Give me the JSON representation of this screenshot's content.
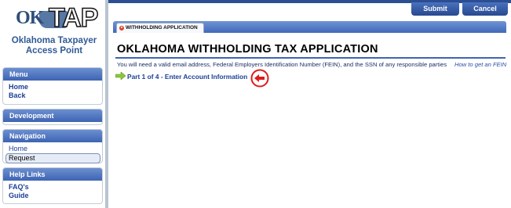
{
  "logo": {
    "ok": "OK",
    "tap": "TAP",
    "line1": "Oklahoma Taxpayer",
    "line2": "Access Point"
  },
  "topbar": {
    "submit_label": "Submit",
    "cancel_label": "Cancel"
  },
  "sidebar": {
    "menu": {
      "title": "Menu",
      "items": [
        "Home",
        "Back"
      ]
    },
    "development": {
      "title": "Development"
    },
    "navigation": {
      "title": "Navigation",
      "items": [
        "Home",
        "Request"
      ]
    },
    "help": {
      "title": "Help Links",
      "items": [
        "FAQ's",
        "Guide"
      ]
    }
  },
  "tab": {
    "label": "WITHHOLDING APPLICATION"
  },
  "main": {
    "title": "OKLAHOMA WITHHOLDING TAX APPLICATION",
    "instructions": "You will need a valid email address, Federal Employers Identification Number (FEIN), and the SSN of any responsible parties",
    "fein_link": "How to get an FEIN",
    "step_link": "Part 1 of 4 - Enter Account Information"
  },
  "colors": {
    "accent": "#3e64b3",
    "link": "#1b3f96",
    "marker": "#e01b1b",
    "arrow": "#8cc63f"
  },
  "icons": {
    "tab_icon": "record-icon",
    "step_icon": "arrow-right-icon",
    "marker_icon": "arrow-left-circle-icon"
  }
}
